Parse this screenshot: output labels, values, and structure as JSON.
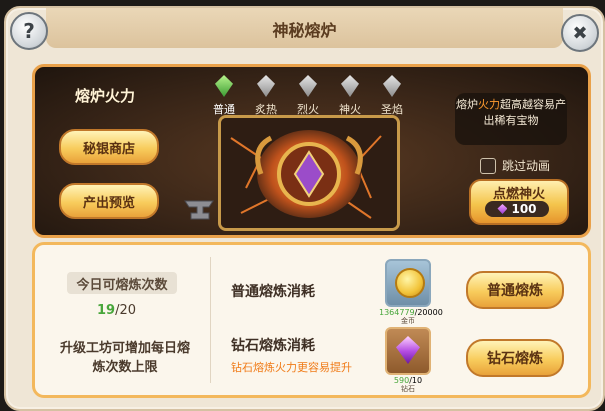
{
  "title": "神秘熔炉",
  "help_label": "?",
  "close_label": "✖",
  "scene": {
    "title": "熔炉火力",
    "shop_button": "秘银商店",
    "preview_button": "产出预览",
    "levels": [
      {
        "label": "普通",
        "active": true
      },
      {
        "label": "炙热",
        "active": false
      },
      {
        "label": "烈火",
        "active": false
      },
      {
        "label": "神火",
        "active": false
      },
      {
        "label": "圣焰",
        "active": false
      }
    ],
    "tip_prefix": "熔炉",
    "tip_highlight": "火力",
    "tip_suffix": "超高越容易产出稀有宝物",
    "skip_label": "跳过动画",
    "ignite_label": "点燃神火",
    "ignite_cost": "100"
  },
  "daily": {
    "title": "今日可熔炼次数",
    "current": "19",
    "max": "/20",
    "upgrade_tip": "升级工坊可增加每日熔炼次数上限"
  },
  "normal": {
    "cost_label": "普通熔炼消耗",
    "have": "1364779",
    "need": "/20000",
    "item_name": "金币",
    "button": "普通熔炼"
  },
  "diamond": {
    "cost_label": "钻石熔炼消耗",
    "sub_tip": "钻石熔炼火力更容易提升",
    "have": "590",
    "need": "/10",
    "item_name": "钻石",
    "button": "钻石熔炼"
  },
  "colors": {
    "accent_orange": "#f3b85c",
    "highlight": "#ff9b2f",
    "green": "#48a63b"
  }
}
